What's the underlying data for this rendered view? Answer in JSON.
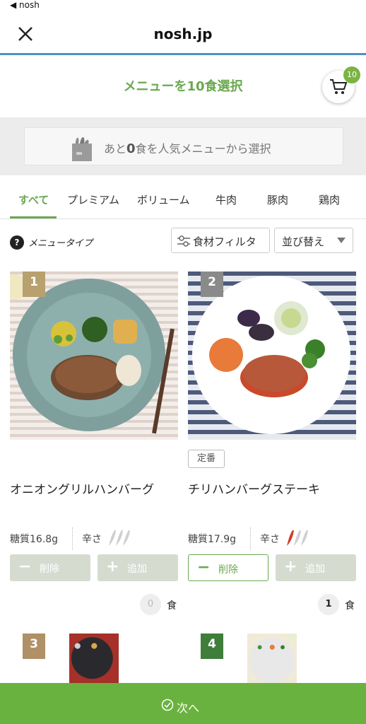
{
  "status_bar": {
    "back_app": "◀ nosh"
  },
  "nav": {
    "title": "nosh.jp"
  },
  "header": {
    "text": "メニューを10食選択",
    "cart_count": "10"
  },
  "banner": {
    "prefix": "あと",
    "count": "0",
    "suffix": "食を人気メニューから選択"
  },
  "tabs": [
    {
      "label": "すべて",
      "active": true
    },
    {
      "label": "プレミアム"
    },
    {
      "label": "ボリューム"
    },
    {
      "label": "牛肉"
    },
    {
      "label": "豚肉"
    },
    {
      "label": "鶏肉"
    }
  ],
  "filters": {
    "info_icon": "?",
    "menu_type": "メニュータイプ",
    "ingredient_filter": "食材フィルタ",
    "sort": "並び替え"
  },
  "products": [
    {
      "rank": "1",
      "tag": "",
      "name": "オニオングリルハンバーグ",
      "carbs": "糖質16.8g",
      "spicy_label": "辛さ",
      "spicy_level": 0,
      "delete_label": "削除",
      "add_label": "追加",
      "count": "0",
      "unit": "食"
    },
    {
      "rank": "2",
      "tag": "定番",
      "name": "チリハンバーグステーキ",
      "carbs": "糖質17.9g",
      "spicy_label": "辛さ",
      "spicy_level": 1,
      "delete_label": "削除",
      "add_label": "追加",
      "count": "1",
      "unit": "食"
    },
    {
      "rank": "3"
    },
    {
      "rank": "4"
    }
  ],
  "bottom": {
    "next_label": "次へ"
  },
  "colors": {
    "accent": "#6aa84f",
    "bottom_bar": "#6ab23f",
    "nav_border": "#4a90c8",
    "rank_gold": "#b8a16e",
    "rank_gray": "#8a8a8a",
    "rank_brown": "#b09066",
    "rank_green": "#3f7d3a"
  }
}
